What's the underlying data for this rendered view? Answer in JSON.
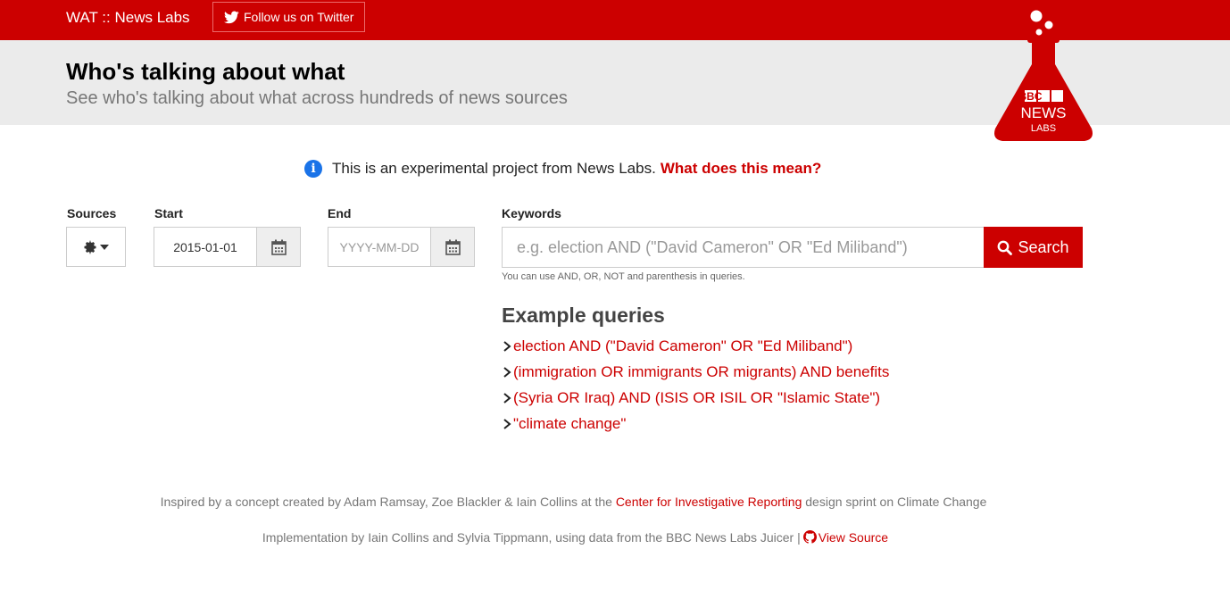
{
  "nav": {
    "brand": "WAT :: News Labs",
    "twitter_label": "Follow us on Twitter"
  },
  "header": {
    "title": "Who's talking about what",
    "subtitle": "See who's talking about what across hundreds of news sources"
  },
  "logo": {
    "line1": "BBC",
    "line2": "NEWS",
    "line3": "LABS"
  },
  "notice": {
    "text": "This is an experimental project from News Labs.",
    "link": "What does this mean?"
  },
  "form": {
    "sources_label": "Sources",
    "start_label": "Start",
    "start_value": "2015-01-01",
    "end_label": "End",
    "end_placeholder": "YYYY-MM-DD",
    "keywords_label": "Keywords",
    "keywords_placeholder": "e.g. election AND (\"David Cameron\" OR \"Ed Miliband\")",
    "search_label": "Search",
    "help_text": "You can use AND, OR, NOT and parenthesis in queries."
  },
  "examples": {
    "title": "Example queries",
    "items": [
      "election AND (\"David Cameron\" OR \"Ed Miliband\")",
      "(immigration OR immigrants OR migrants) AND benefits",
      "(Syria OR Iraq) AND (ISIS OR ISIL OR \"Islamic State\")",
      "\"climate change\""
    ]
  },
  "footer": {
    "line1_prefix": "Inspired by a concept created by Adam Ramsay, Zoe Blackler & Iain Collins at the",
    "line1_link": "Center for Investigative Reporting",
    "line1_suffix": "design sprint on Climate Change",
    "line2_prefix": "Implementation by Iain Collins and Sylvia Tippmann, using data from the BBC News Labs Juicer |",
    "line2_link": "View Source"
  },
  "colors": {
    "brand_red": "#cc0000",
    "header_gray": "#ebebeb",
    "info_blue": "#1a73e8"
  },
  "icons": [
    "twitter-icon",
    "info-icon",
    "gear-icon",
    "caret-down-icon",
    "calendar-icon",
    "search-icon",
    "chevron-right-icon",
    "github-icon",
    "flask-logo"
  ]
}
